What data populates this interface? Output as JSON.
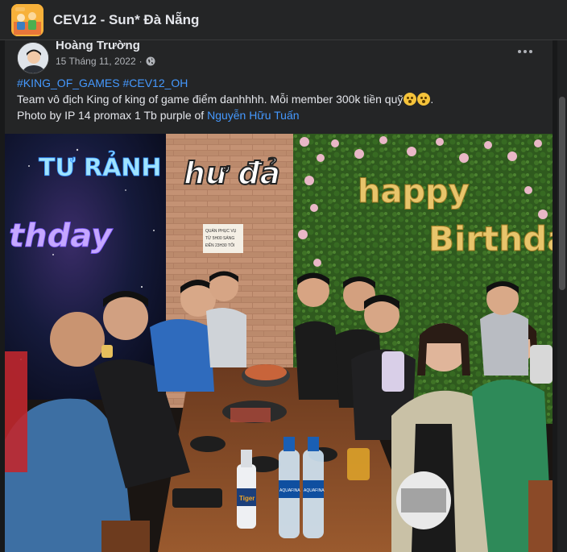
{
  "group": {
    "title": "CEV12 - Sun* Đà Nẵng",
    "icon": "group-cover-icon"
  },
  "post": {
    "author": "Hoàng Trường",
    "date": "15 Tháng 11, 2022",
    "separator": "·",
    "privacy_icon": "globe-icon",
    "hashtags": [
      "#KING_OF_GAMES",
      "#CEV12_OH"
    ],
    "line2_text": "Team vô địch King of king of game điểm danhhhh. Mỗi member 300k tiền quỹ",
    "line2_end": ".",
    "line3_prefix": "Photo by IP 14 promax 1 Tb purple of ",
    "line3_link": "Nguyễn Hữu Tuấn",
    "more_icon": "more-options-icon"
  },
  "photo": {
    "neon_left_top": "TƯ RẢNH",
    "neon_left_bottom": "thday",
    "restaurant_logo": "hư đả",
    "happy": "happy",
    "birthday": "Birthda",
    "sign_lines": [
      "QUÁN PHỤC VỤ",
      "TỪ 5H00 SÁNG",
      "ĐẾN 23H30 TỐI"
    ],
    "beer_label": "Tiger",
    "water_label": "AQUAFINA"
  },
  "colors": {
    "background": "#18191a",
    "card": "#242526",
    "link": "#4599ff",
    "text": "#e4e6eb",
    "muted": "#b0b3b8"
  }
}
